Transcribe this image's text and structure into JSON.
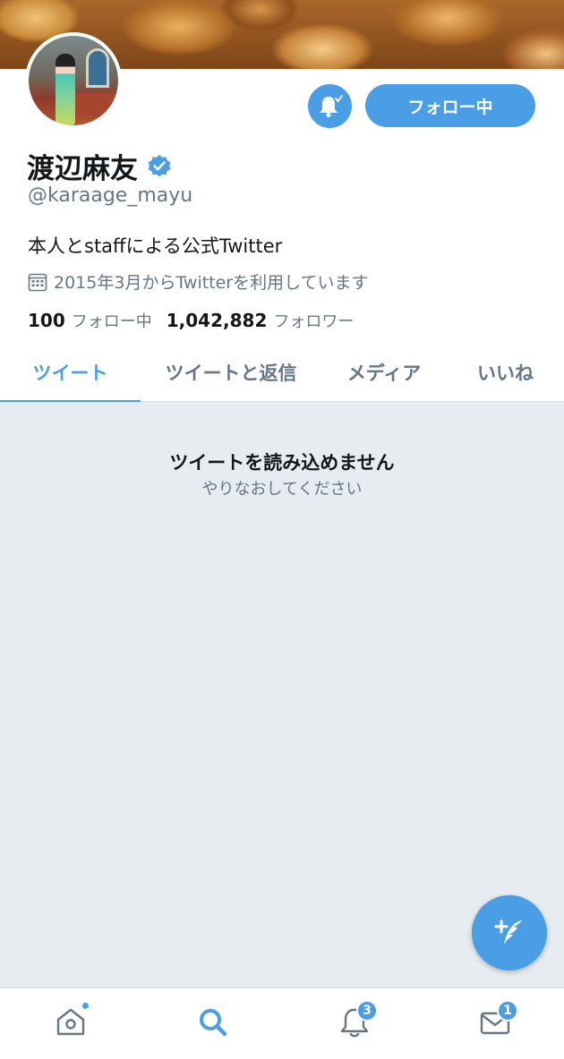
{
  "profile": {
    "display_name": "渡辺麻友",
    "handle": "@karaage_mayu",
    "bio": "本人とstaffによる公式Twitter",
    "joined": "2015年3月からTwitterを利用しています",
    "following_count": "100",
    "following_label": "フォロー中",
    "followers_count": "1,042,882",
    "followers_label": "フォロワー",
    "verified": true
  },
  "actions": {
    "follow_label": "フォロー中"
  },
  "tabs": [
    {
      "label": "ツイート",
      "active": true
    },
    {
      "label": "ツイートと返信",
      "active": false
    },
    {
      "label": "メディア",
      "active": false
    },
    {
      "label": "いいね",
      "active": false
    }
  ],
  "feed": {
    "error_title": "ツイートを読み込めません",
    "error_subtitle": "やりなおしてください"
  },
  "tabbar": {
    "home_has_dot": true,
    "notifications_badge": "3",
    "messages_badge": "1"
  },
  "colors": {
    "accent": "#4a9ee6",
    "muted_text": "#657786",
    "feed_background": "#e6ecf0"
  },
  "icons": {
    "bell": "bell-check-icon",
    "verified": "verified-badge-icon",
    "calendar": "calendar-icon",
    "compose": "compose-tweet-icon",
    "home": "home-icon",
    "search": "search-icon",
    "notifications": "notifications-bell-icon",
    "messages": "messages-envelope-icon"
  }
}
